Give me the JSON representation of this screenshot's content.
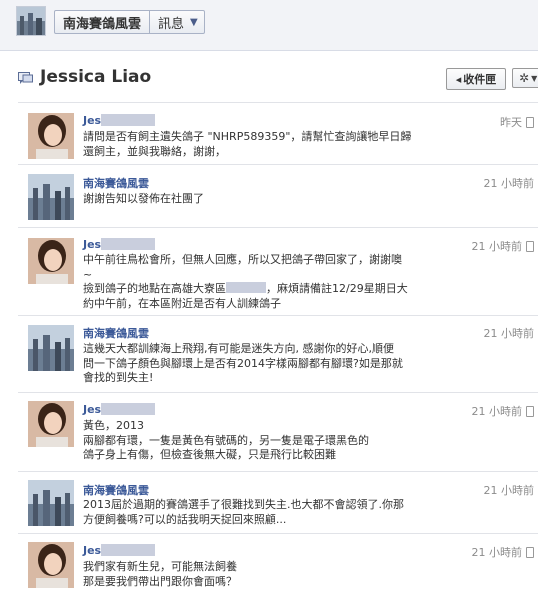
{
  "topbar": {
    "page_name": "南海賽鴿風雲",
    "mode_label": "訊息"
  },
  "thread": {
    "title": "Jessica Liao",
    "inbox_button": "收件匣",
    "back_arrow": "◂",
    "gear_symbol": "✲"
  },
  "icons": {
    "chat": "chat-bubble-icon",
    "phone": "mobile-phone-icon",
    "gear": "gear-icon"
  },
  "messages": [
    {
      "sender": "Jes",
      "redacted_sender": true,
      "time": "昨天",
      "mobile": true,
      "lines": [
        "請問是否有飼主遺失鴿子 \"NHRP589359\"，請幫忙查詢讓牠早日歸",
        "還飼主，並與我聯絡，謝謝，"
      ]
    },
    {
      "sender": "南海賽鴿風雲",
      "redacted_sender": false,
      "time": "21 小時前",
      "mobile": false,
      "lines": [
        "謝謝告知以發佈在社團了"
      ]
    },
    {
      "sender": "Jes",
      "redacted_sender": true,
      "time": "21 小時前",
      "mobile": true,
      "lines": [
        "中午前往鳥松會所，但無人回應，所以又把鴿子帶回家了，謝謝噢",
        "~",
        "撿到鴿子的地點在高雄大寮區",
        "，麻煩請備註12/29星期日大",
        "約中午前，在本區附近是否有人訓練鴿子"
      ]
    },
    {
      "sender": "南海賽鴿風雲",
      "redacted_sender": false,
      "time": "21 小時前",
      "mobile": false,
      "lines": [
        "這幾天大都訓練海上飛翔,有可能是迷失方向, 感謝你的好心,順便",
        "問一下鴿子顏色與腳環上是否有2014字樣兩腳都有腳環?如是那就",
        "會找的到失主!"
      ]
    },
    {
      "sender": "Jes",
      "redacted_sender": true,
      "time": "21 小時前",
      "mobile": true,
      "lines": [
        "黃色，2013",
        "兩腳都有環，一隻是黃色有號碼的，另一隻是電子環黑色的",
        "鴿子身上有傷，但檢查後無大礙，只是飛行比較困難"
      ]
    },
    {
      "sender": "南海賽鴿風雲",
      "redacted_sender": false,
      "time": "21 小時前",
      "mobile": false,
      "lines": [
        "2013屆於過期的賽鴿選手了很難找到失主.也大都不會認領了.你那",
        "方便飼養嗎?可以的話我明天捉回來照顧..."
      ]
    },
    {
      "sender": "Jes",
      "redacted_sender": true,
      "time": "21 小時前",
      "mobile": true,
      "lines": [
        "我們家有新生兒，可能無法飼養",
        "那是要我們帶出門跟你會面嗎？"
      ]
    }
  ]
}
